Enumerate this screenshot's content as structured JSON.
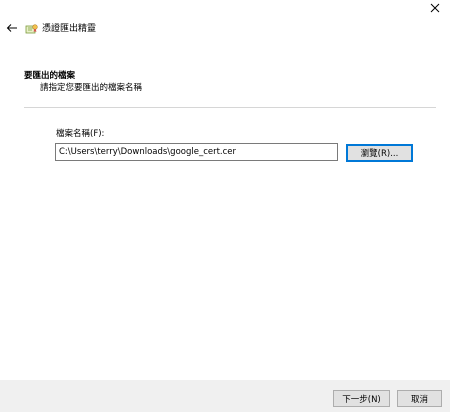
{
  "window": {
    "close_icon": "close-icon"
  },
  "header": {
    "back_icon": "back-arrow-icon",
    "wizard_icon": "certificate-icon",
    "title": "憑證匯出精靈"
  },
  "section": {
    "title": "要匯出的檔案",
    "description": "請指定您要匯出的檔案名稱"
  },
  "file": {
    "label": "檔案名稱(F):",
    "value": "C:\\Users\\terry\\Downloads\\google_cert.cer",
    "browse_label": "瀏覽(R)..."
  },
  "footer": {
    "next_label": "下一步(N)",
    "cancel_label": "取消"
  },
  "colors": {
    "accent": "#0078d7",
    "footer_bg": "#f0f0f0",
    "button_bg": "#e1e1e1"
  }
}
